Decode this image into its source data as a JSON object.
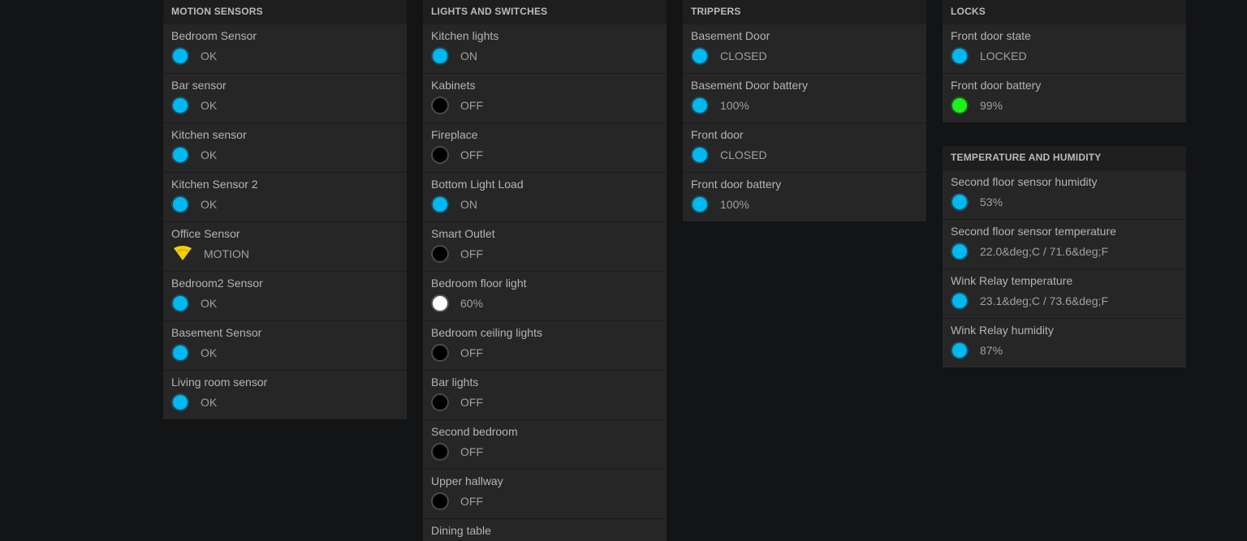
{
  "colors": {
    "ok": "#00b9f0",
    "off": "#000000",
    "dim": "#ffffff",
    "battery_good": "#1bf21b",
    "motion": "#f2cf00"
  },
  "motion_sensors": {
    "title": "MOTION SENSORS",
    "items": [
      {
        "name": "Bedroom Sensor",
        "state": "OK",
        "icon": "status-dot-blue"
      },
      {
        "name": "Bar sensor",
        "state": "OK",
        "icon": "status-dot-blue"
      },
      {
        "name": "Kitchen sensor",
        "state": "OK",
        "icon": "status-dot-blue"
      },
      {
        "name": "Kitchen Sensor 2",
        "state": "OK",
        "icon": "status-dot-blue"
      },
      {
        "name": "Office Sensor",
        "state": "MOTION",
        "icon": "motion-wave-icon"
      },
      {
        "name": "Bedroom2 Sensor",
        "state": "OK",
        "icon": "status-dot-blue"
      },
      {
        "name": "Basement Sensor",
        "state": "OK",
        "icon": "status-dot-blue"
      },
      {
        "name": "Living room sensor",
        "state": "OK",
        "icon": "status-dot-blue"
      }
    ]
  },
  "lights_switches": {
    "title": "LIGHTS AND SWITCHES",
    "items": [
      {
        "name": "Kitchen lights",
        "state": "ON",
        "icon": "status-dot-blue"
      },
      {
        "name": "Kabinets",
        "state": "OFF",
        "icon": "status-dot-black"
      },
      {
        "name": "Fireplace",
        "state": "OFF",
        "icon": "status-dot-black"
      },
      {
        "name": "Bottom Light Load",
        "state": "ON",
        "icon": "status-dot-blue"
      },
      {
        "name": "Smart Outlet",
        "state": "OFF",
        "icon": "status-dot-black"
      },
      {
        "name": "Bedroom floor light",
        "state": "60%",
        "icon": "status-dot-white"
      },
      {
        "name": "Bedroom ceiling lights",
        "state": "OFF",
        "icon": "status-dot-black"
      },
      {
        "name": "Bar lights",
        "state": "OFF",
        "icon": "status-dot-black"
      },
      {
        "name": "Second bedroom",
        "state": "OFF",
        "icon": "status-dot-black"
      },
      {
        "name": "Upper hallway",
        "state": "OFF",
        "icon": "status-dot-black"
      },
      {
        "name": "Dining table",
        "state": "",
        "icon": ""
      }
    ]
  },
  "trippers": {
    "title": "TRIPPERS",
    "items": [
      {
        "name": "Basement Door",
        "state": "CLOSED",
        "icon": "status-dot-blue"
      },
      {
        "name": "Basement Door battery",
        "state": "100%",
        "icon": "status-dot-blue"
      },
      {
        "name": "Front door",
        "state": "CLOSED",
        "icon": "status-dot-blue"
      },
      {
        "name": "Front door battery",
        "state": "100%",
        "icon": "status-dot-blue"
      }
    ]
  },
  "locks": {
    "title": "LOCKS",
    "items": [
      {
        "name": "Front door state",
        "state": "LOCKED",
        "icon": "status-dot-blue"
      },
      {
        "name": "Front door battery",
        "state": "99%",
        "icon": "status-dot-green"
      }
    ]
  },
  "temperature_humidity": {
    "title": "TEMPERATURE AND HUMIDITY",
    "items": [
      {
        "name": "Second floor sensor humidity",
        "state": "53%",
        "icon": "status-dot-blue"
      },
      {
        "name": "Second floor sensor temperature",
        "state": "22.0&deg;C / 71.6&deg;F",
        "icon": "status-dot-blue"
      },
      {
        "name": "Wink Relay temperature",
        "state": "23.1&deg;C / 73.6&deg;F",
        "icon": "status-dot-blue"
      },
      {
        "name": "Wink Relay humidity",
        "state": "87%",
        "icon": "status-dot-blue"
      }
    ]
  }
}
